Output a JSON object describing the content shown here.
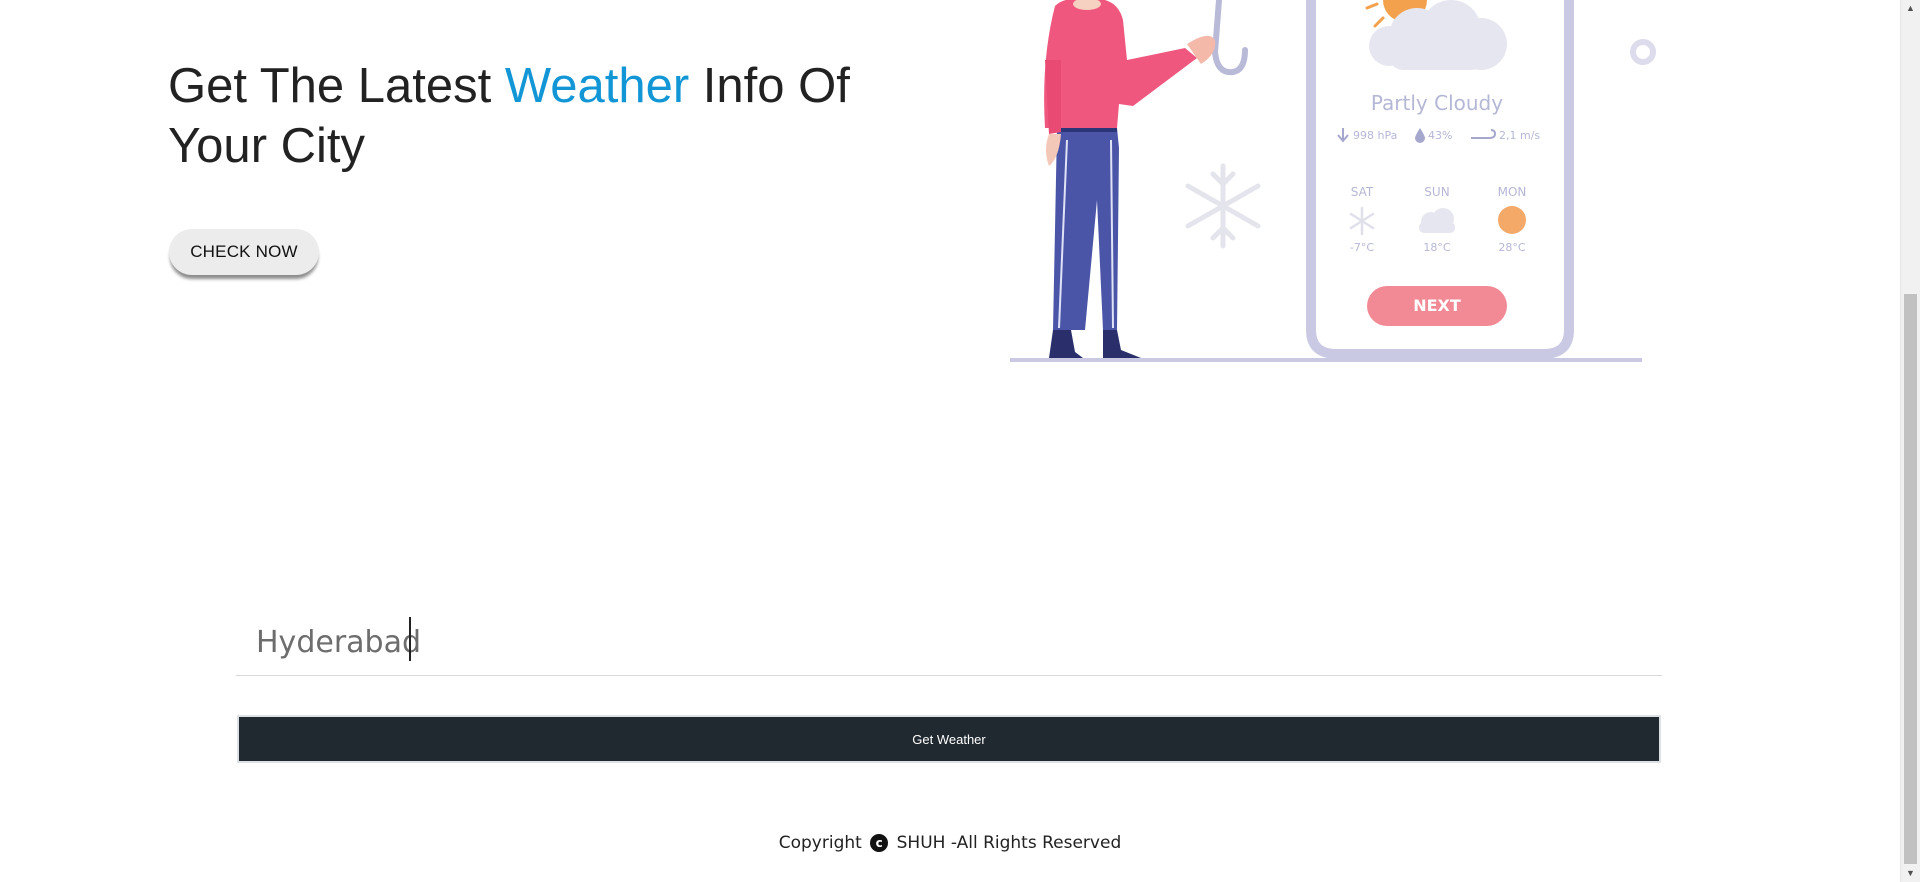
{
  "hero": {
    "title_before": "Get The Latest ",
    "title_accent": "Weather",
    "title_after": " Info Of Your City",
    "check_button": "CHECK NOW"
  },
  "illustration": {
    "condition": "Partly Cloudy",
    "pressure": "998 hPa",
    "humidity": "43%",
    "wind": "2,1 m/s",
    "forecast": [
      {
        "day": "SAT",
        "temp": "-7°C",
        "icon": "snowflake-icon"
      },
      {
        "day": "SUN",
        "temp": "18°C",
        "icon": "cloud-icon"
      },
      {
        "day": "MON",
        "temp": "28°C",
        "icon": "sun-icon"
      }
    ],
    "next_button": "NEXT"
  },
  "search": {
    "value": "Hyderabad",
    "button": "Get Weather"
  },
  "footer": {
    "before": "Copyright",
    "icon_glyph": "c",
    "after": "SHUH -All Rights Reserved"
  },
  "colors": {
    "accent": "#1296d6",
    "button_dark": "#212930",
    "phone_frame": "#c9c9e3",
    "next_button": "#f28a96",
    "shirt": "#f0577f",
    "pants": "#4b55a8"
  }
}
